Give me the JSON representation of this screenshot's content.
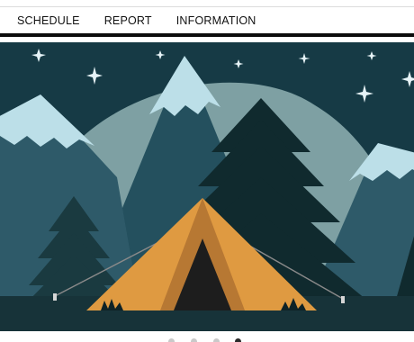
{
  "nav": {
    "items": [
      {
        "label": "SCHEDULE"
      },
      {
        "label": "REPORT"
      },
      {
        "label": "INFORMATION"
      }
    ]
  },
  "carousel": {
    "image": {
      "icon": "camping-tent-mountains-illustration",
      "colors": {
        "sky": "#163a45",
        "far_hill": "#7ea0a3",
        "snow": "#bcdfe8",
        "mountain_mid": "#24505e",
        "mountain_dark": "#1f4652",
        "pine_dark": "#102a2e",
        "ground": "#173339",
        "tent": "#df9a41",
        "tent_shadow": "#b77833",
        "tent_door": "#1d1d1d",
        "star": "#e6f3f7"
      }
    },
    "slide_count": 4,
    "active_slide": 4
  }
}
